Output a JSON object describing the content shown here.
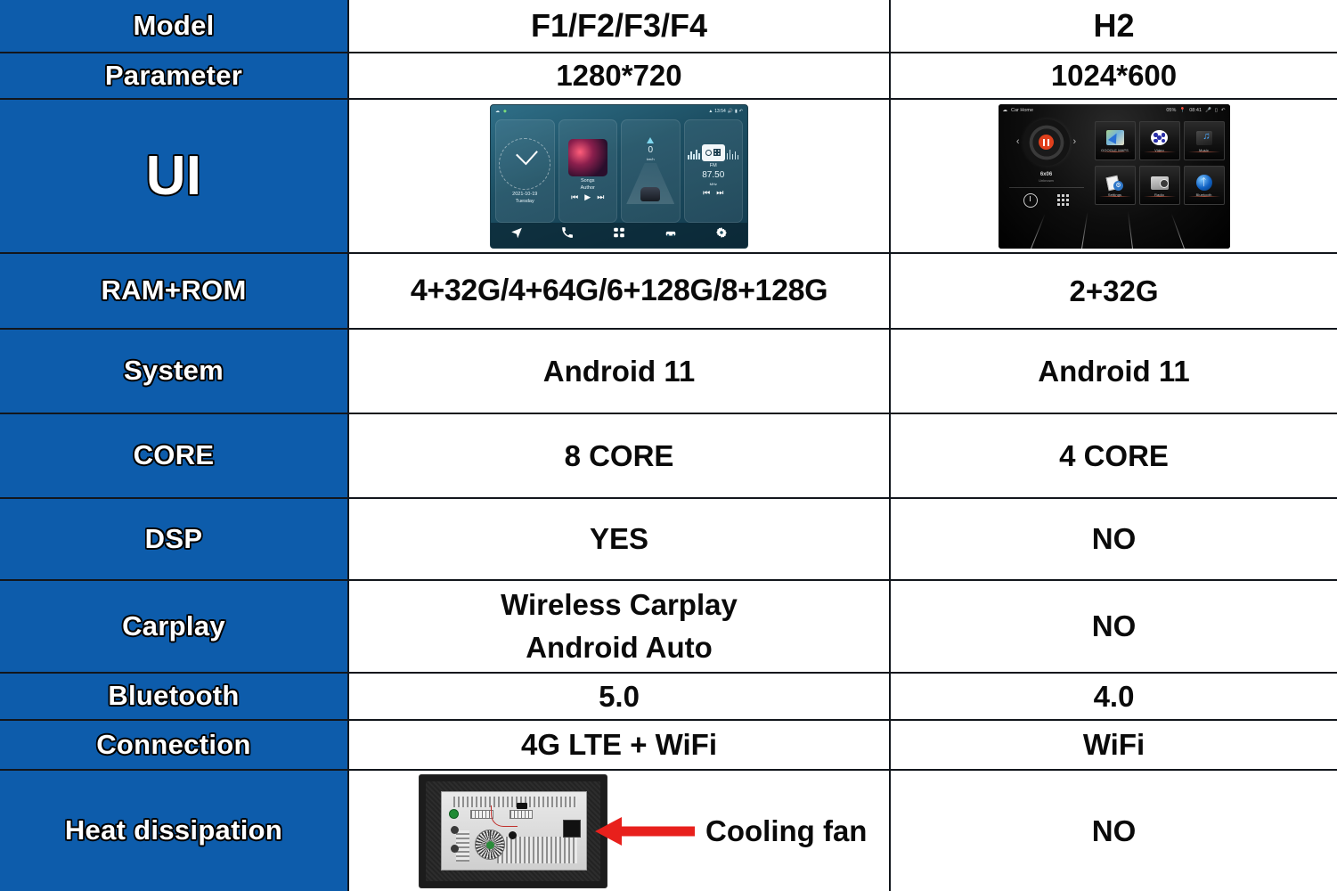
{
  "table": {
    "columns": [
      "Model",
      "F1/F2/F3/F4",
      "H2"
    ],
    "rows": [
      {
        "label": "Model",
        "mid": "F1/F2/F3/F4",
        "right": "H2"
      },
      {
        "label": "Parameter",
        "mid": "1280*720",
        "right": "1024*600"
      },
      {
        "label": "UI",
        "mid": "",
        "right": ""
      },
      {
        "label": "RAM+ROM",
        "mid": "4+32G/4+64G/6+128G/8+128G",
        "right": "2+32G"
      },
      {
        "label": "System",
        "mid": "Android 11",
        "right": "Android 11"
      },
      {
        "label": "CORE",
        "mid": "8 CORE",
        "right": "4 CORE"
      },
      {
        "label": "DSP",
        "mid": "YES",
        "right": "NO"
      },
      {
        "label": "Carplay",
        "mid_line1": "Wireless Carplay",
        "mid_line2": "Android Auto",
        "right": "NO"
      },
      {
        "label": "Bluetooth",
        "mid": "5.0",
        "right": "4.0"
      },
      {
        "label": "Connection",
        "mid": "4G LTE + WiFi",
        "right": "WiFi"
      },
      {
        "label": "Heat dissipation",
        "mid": "Cooling fan",
        "right": "NO"
      }
    ]
  },
  "f_ui": {
    "status_left": "",
    "status_right": "13:54",
    "clock": {
      "date": "2021-10-19",
      "day": "Tuesday"
    },
    "music": {
      "title": "Songs",
      "artist": "Author"
    },
    "speed": {
      "value": "0",
      "unit": "km/h"
    },
    "radio": {
      "band": "FM",
      "freq": "87.50",
      "unit": "MHz"
    },
    "dock": [
      "navigation-icon",
      "phone-icon",
      "apps-icon",
      "dvr-icon",
      "settings-icon"
    ]
  },
  "h_ui": {
    "status_title": "Car Home",
    "status_battery": "05%",
    "status_time": "08:41",
    "track_title": "6x06",
    "track_sub": "Unknown",
    "apps": [
      {
        "name": "GOOGLE MAPS",
        "icon": "map-icon"
      },
      {
        "name": "Video",
        "icon": "video-icon"
      },
      {
        "name": "Music",
        "icon": "music-icon"
      },
      {
        "name": "Settings",
        "icon": "settings-icon"
      },
      {
        "name": "Radio",
        "icon": "radio-icon"
      },
      {
        "name": "Bluetooth",
        "icon": "bluetooth-icon"
      }
    ]
  },
  "colors": {
    "label_blue": "#0d5cab",
    "border": "#12161c",
    "arrow_red": "#e8201c",
    "text_dark": "#0a0a0a",
    "text_light": "#ffffff"
  }
}
